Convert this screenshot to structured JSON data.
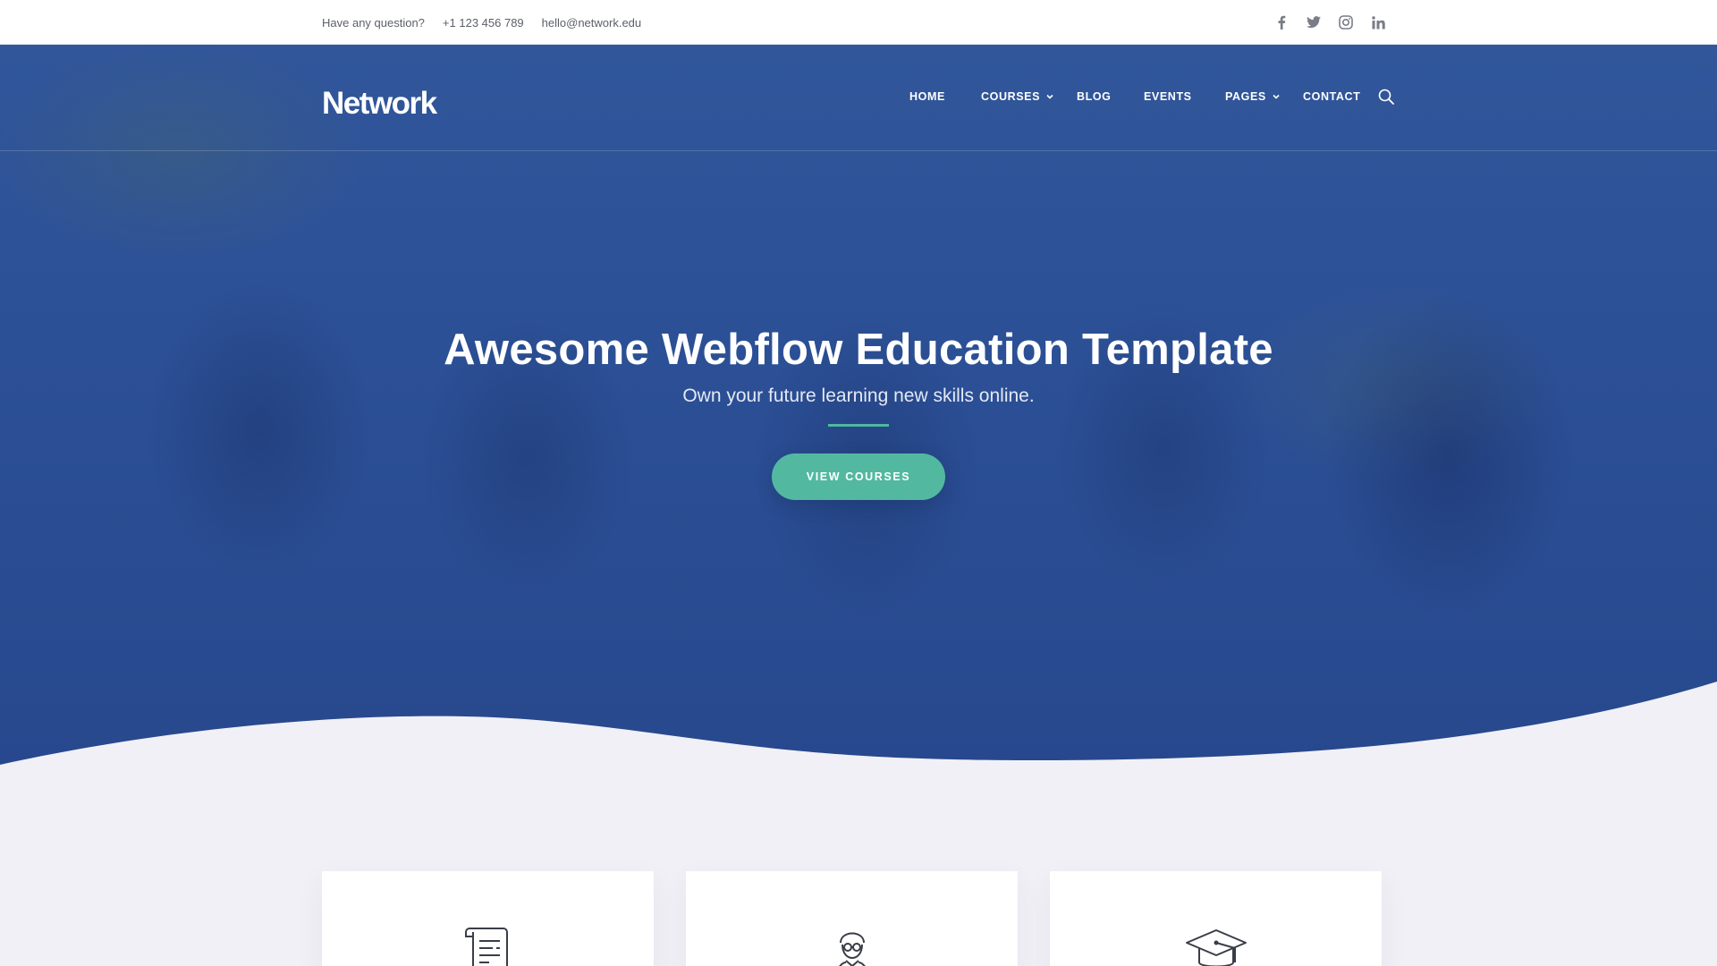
{
  "topbar": {
    "question": "Have any question?",
    "phone": "+1 123 456 789",
    "email": "hello@network.edu",
    "social": [
      {
        "icon": "facebook-icon"
      },
      {
        "icon": "twitter-icon"
      },
      {
        "icon": "instagram-icon"
      },
      {
        "icon": "linkedin-icon"
      }
    ]
  },
  "header": {
    "logo": "Network",
    "nav": [
      {
        "label": "HOME",
        "dropdown": false
      },
      {
        "label": "COURSES",
        "dropdown": true
      },
      {
        "label": "BLOG",
        "dropdown": false
      },
      {
        "label": "EVENTS",
        "dropdown": false
      },
      {
        "label": "PAGES",
        "dropdown": true
      },
      {
        "label": "CONTACT",
        "dropdown": false
      }
    ],
    "search_icon": "search-icon"
  },
  "hero": {
    "title": "Awesome Webflow Education Template",
    "subtitle": "Own your future learning new skills online.",
    "cta_label": "VIEW COURSES"
  },
  "features": [
    {
      "icon": "certificate-icon"
    },
    {
      "icon": "teacher-icon"
    },
    {
      "icon": "graduation-cap-icon"
    }
  ],
  "colors": {
    "hero_blue": "#2c5096",
    "accent_teal": "#52b9a0",
    "page_bg": "#f1f0f6"
  }
}
